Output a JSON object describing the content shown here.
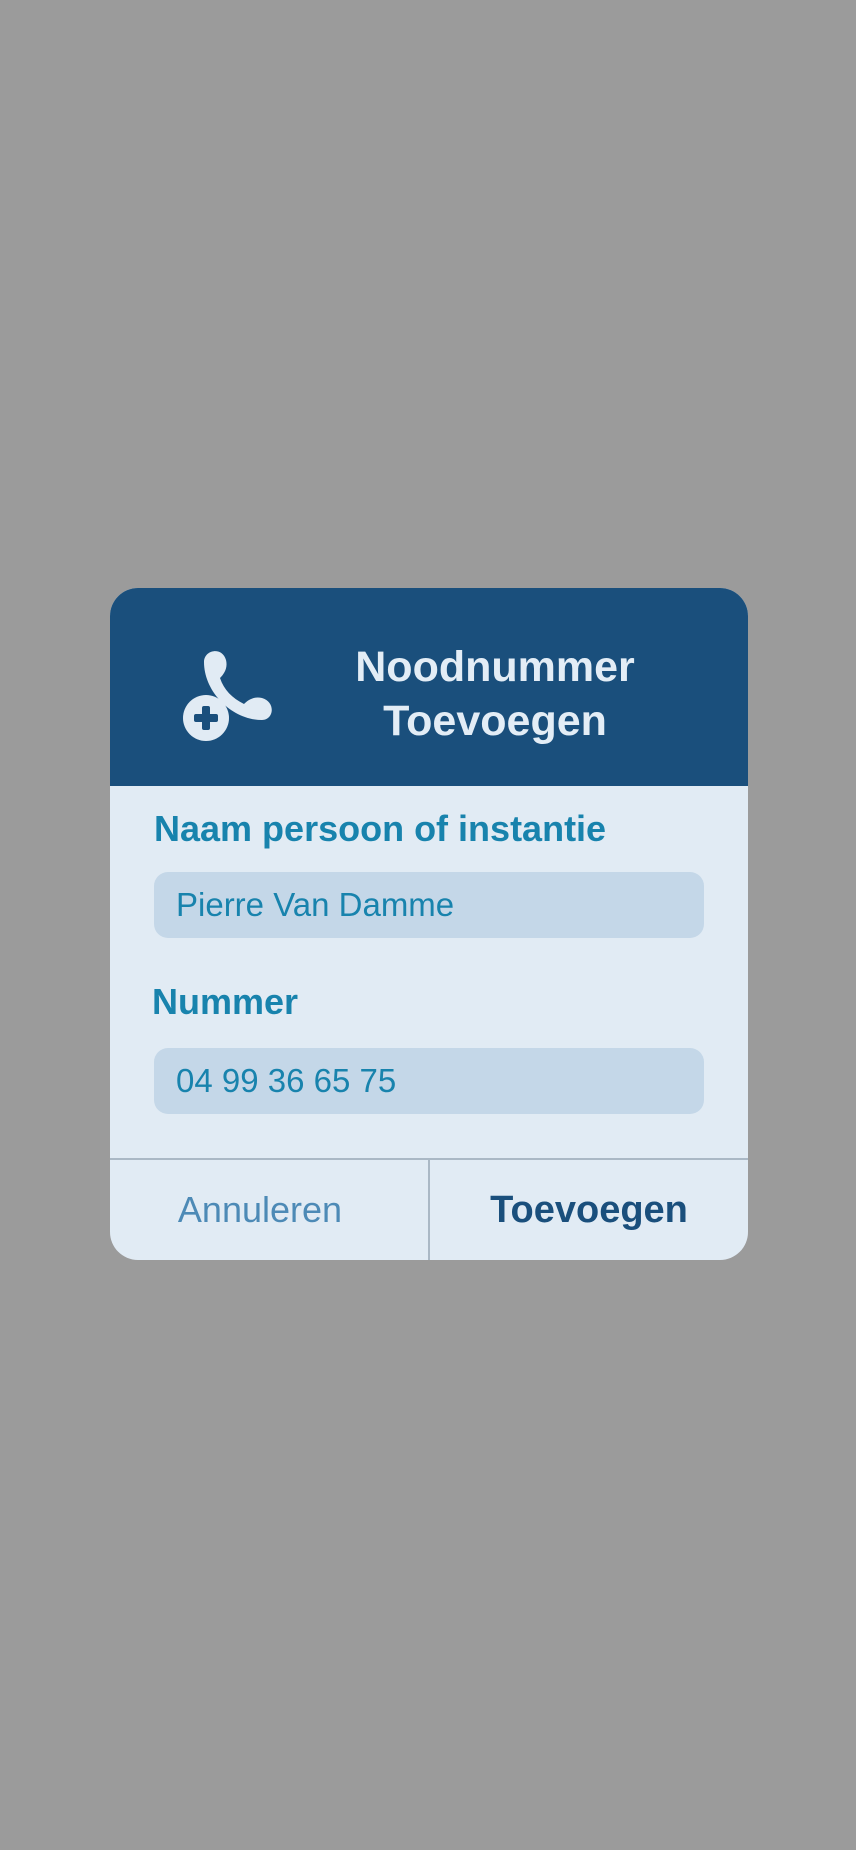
{
  "dialog": {
    "icon": "add-phone-icon",
    "title_line1": "Noodnummer",
    "title_line2": "Toevoegen",
    "name_label": "Naam persoon of instantie",
    "name_value": "Pierre Van Damme",
    "number_label": "Nummer",
    "number_value": "04 99 36 65 75",
    "cancel_label": "Annuleren",
    "add_label": "Toevoegen"
  },
  "colors": {
    "backdrop": "#9b9b9b",
    "header": "#1a4f7c",
    "body": "#e1ebf4",
    "field": "#c4d7e8",
    "accent": "#1883ad"
  }
}
